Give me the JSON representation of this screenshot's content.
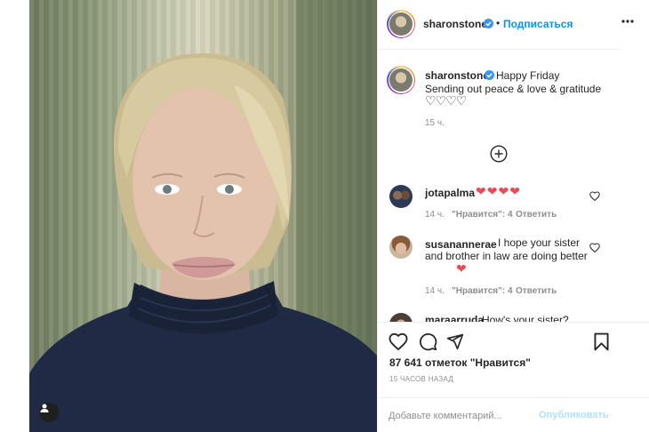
{
  "post": {
    "username": "sharonstone",
    "follow_label": "Подписаться",
    "dot": "•",
    "caption_title": "Happy Friday",
    "caption_line2": "Sending out peace & love & gratitude",
    "caption_hearts": "♡♡♡♡",
    "caption_time": "15 ч.",
    "load_more_icon": "plus-circle-icon"
  },
  "comments": [
    {
      "username": "jotapalma",
      "text": "",
      "emoji": "❤❤❤❤",
      "time": "14 ч.",
      "likes": "\"Нравится\": 4",
      "reply": "Ответить"
    },
    {
      "username": "susanannerae",
      "text": "I hope your sister and brother in law are doing better",
      "emoji": "❤",
      "time": "14 ч.",
      "likes": "\"Нравится\": 4",
      "reply": "Ответить"
    },
    {
      "username": "maraarruda",
      "text": "How's your sister?"
    }
  ],
  "footer": {
    "likes_text": "87 641 отметок \"Нравится\"",
    "time_ago": "15 ЧАСОВ НАЗАД",
    "comment_placeholder": "Добавьте комментарий...",
    "publish_label": "Опубликовать"
  },
  "colors": {
    "accent": "#0095f6",
    "heart": "#ed4956",
    "publish_disabled": "#b2dffc",
    "secondary_text": "#8e8e8e"
  }
}
